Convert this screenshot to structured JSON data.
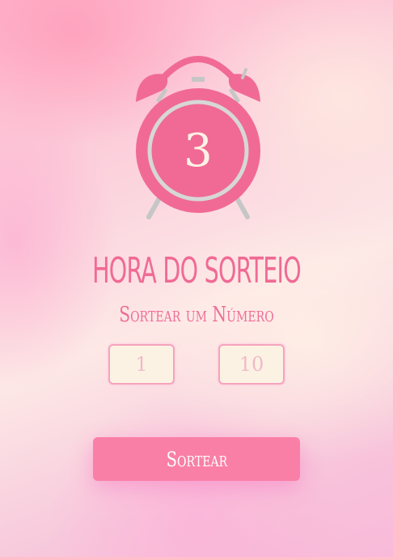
{
  "clock": {
    "value": "3",
    "icon": "alarm-clock-icon"
  },
  "header": {
    "title": "HORA DO SORTEIO",
    "subtitle": "Sortear um Número"
  },
  "range": {
    "min_placeholder": "1",
    "max_placeholder": "10"
  },
  "actions": {
    "draw_label": "Sortear"
  },
  "colors": {
    "accent": "#f97fa6",
    "clock_body": "#f06a95",
    "input_bg": "#fbf2e3",
    "input_border": "#f6a3bd"
  }
}
